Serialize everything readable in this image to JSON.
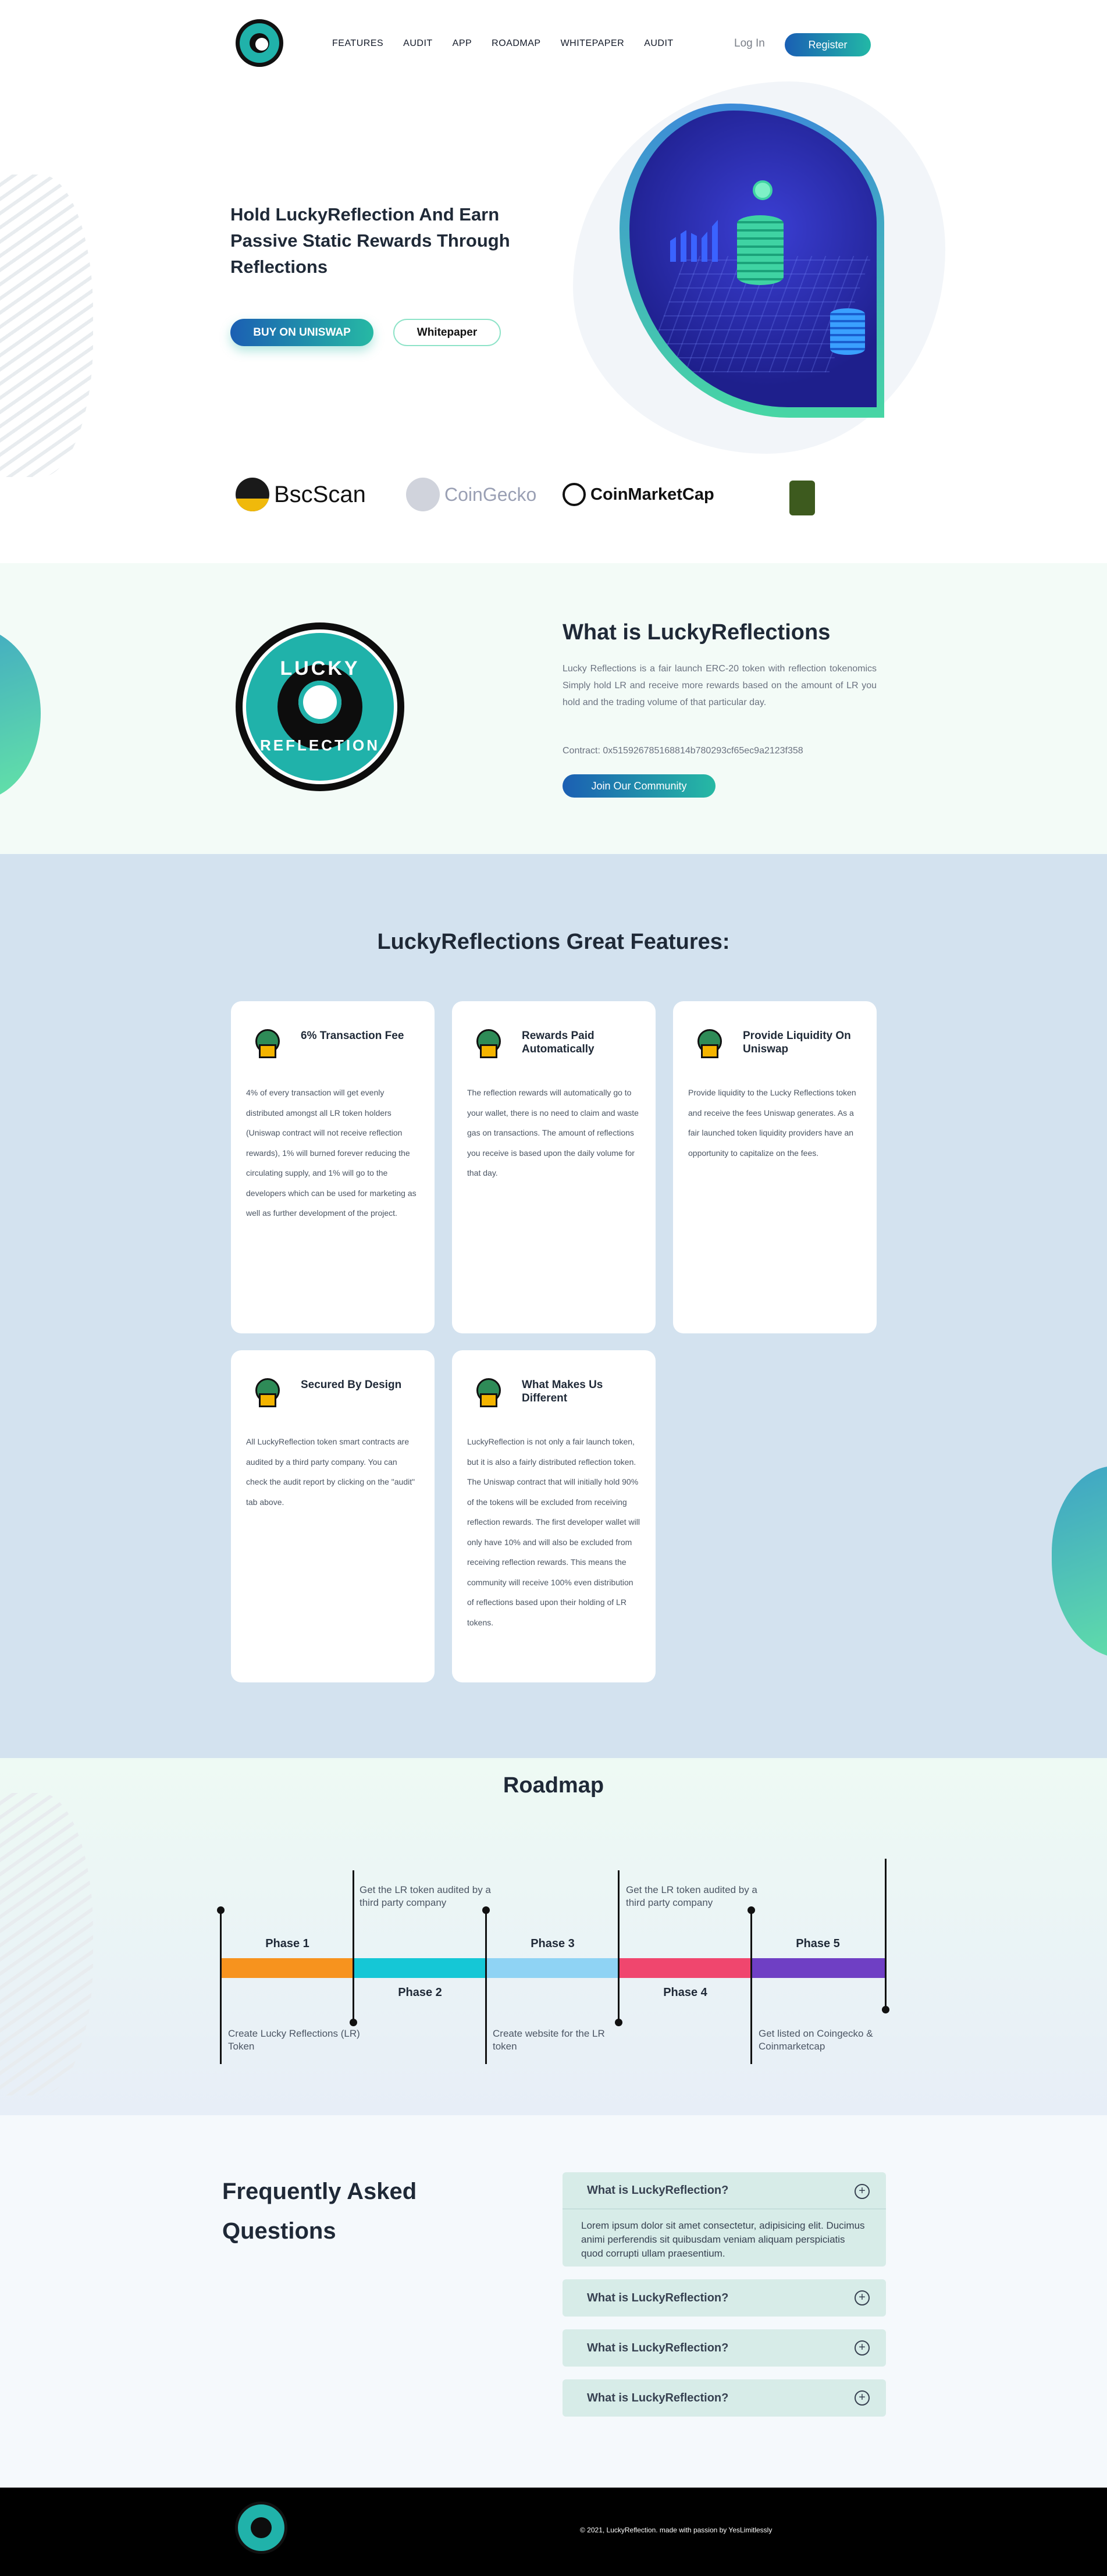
{
  "header": {
    "nav": [
      "FEATURES",
      "AUDIT",
      "APP",
      "ROADMAP",
      "WHITEPAPER",
      "AUDIT"
    ],
    "login": "Log In",
    "register": "Register"
  },
  "hero": {
    "title": "Hold LuckyReflection And Earn Passive Static Rewards Through Reflections",
    "buy_button": "BUY ON UNISWAP",
    "whitepaper_button": "Whitepaper"
  },
  "partners": [
    "BscScan",
    "CoinGecko",
    "CoinMarketCap"
  ],
  "logo": {
    "word_top": "LUCKY",
    "word_bottom": "REFLECTION"
  },
  "about": {
    "title": "What is LuckyReflections",
    "text": "Lucky Reflections is a fair launch ERC-20 token with reflection tokenomics Simply hold LR and receive more rewards based on the amount of LR you hold and the trading volume of that particular day.",
    "contract": "Contract: 0x515926785168814b780293cf65ec9a2123f358",
    "community_button": "Join Our Community"
  },
  "features": {
    "title": "LuckyReflections Great Features:",
    "cards": [
      {
        "title": "6% Transaction Fee",
        "text": "4% of every transaction will get evenly distributed amongst all LR token holders (Uniswap contract will not receive reflection rewards), 1% will burned forever reducing the circulating supply, and 1% will go to the developers which can be used for marketing as well as further development of the project."
      },
      {
        "title": "Rewards Paid Automatically",
        "text": "The reflection rewards will automatically go to your wallet, there is no need to claim and waste gas on transactions. The amount of reflections you receive is based upon the daily volume for that day."
      },
      {
        "title": "Provide Liquidity On Uniswap",
        "text": "Provide liquidity to the Lucky Reflections token and receive the fees Uniswap generates. As a fair launched token liquidity providers have an opportunity to capitalize on the fees."
      },
      {
        "title": "Secured By Design",
        "text": "All LuckyReflection token smart contracts are audited by a third party company. You can check the audit report by clicking on the \"audit\" tab above."
      },
      {
        "title": "What Makes Us Different",
        "text": "LuckyReflection is not only a fair launch token, but it is also a fairly distributed reflection token. The Uniswap contract that will initially hold 90% of the tokens will be excluded from receiving reflection rewards. The first developer wallet will only have 10% and will also be excluded from receiving reflection rewards. This means the community will receive 100% even distribution of reflections based upon their holding of LR tokens."
      }
    ]
  },
  "roadmap": {
    "title": "Roadmap",
    "phases": [
      "Phase 1",
      "Phase 2",
      "Phase 3",
      "Phase 4",
      "Phase 5"
    ],
    "colors": [
      "#f7931e",
      "#15c7d6",
      "#8fd3f4",
      "#f0466e",
      "#6f3fc4"
    ],
    "notes_bottom": [
      "Create Lucky Reflections (LR) Token",
      "Create website for the LR token",
      "Get listed on Coingecko & Coinmarketcap"
    ],
    "notes_top": [
      "Get the LR token audited by a third party company",
      "Get the LR token audited by a third party company"
    ]
  },
  "faq": {
    "title": "Frequently Asked Questions",
    "items": [
      {
        "q": "What is LuckyReflection?",
        "a": "Lorem ipsum dolor sit amet consectetur, adipisicing elit. Ducimus animi perferendis sit quibusdam veniam aliquam perspiciatis quod corrupti ullam praesentium."
      },
      {
        "q": "What is LuckyReflection?"
      },
      {
        "q": "What is LuckyReflection?"
      },
      {
        "q": "What is LuckyReflection?"
      }
    ]
  },
  "footer": {
    "text": "© 2021, LuckyReflection. made with passion by YesLimitlessly"
  }
}
